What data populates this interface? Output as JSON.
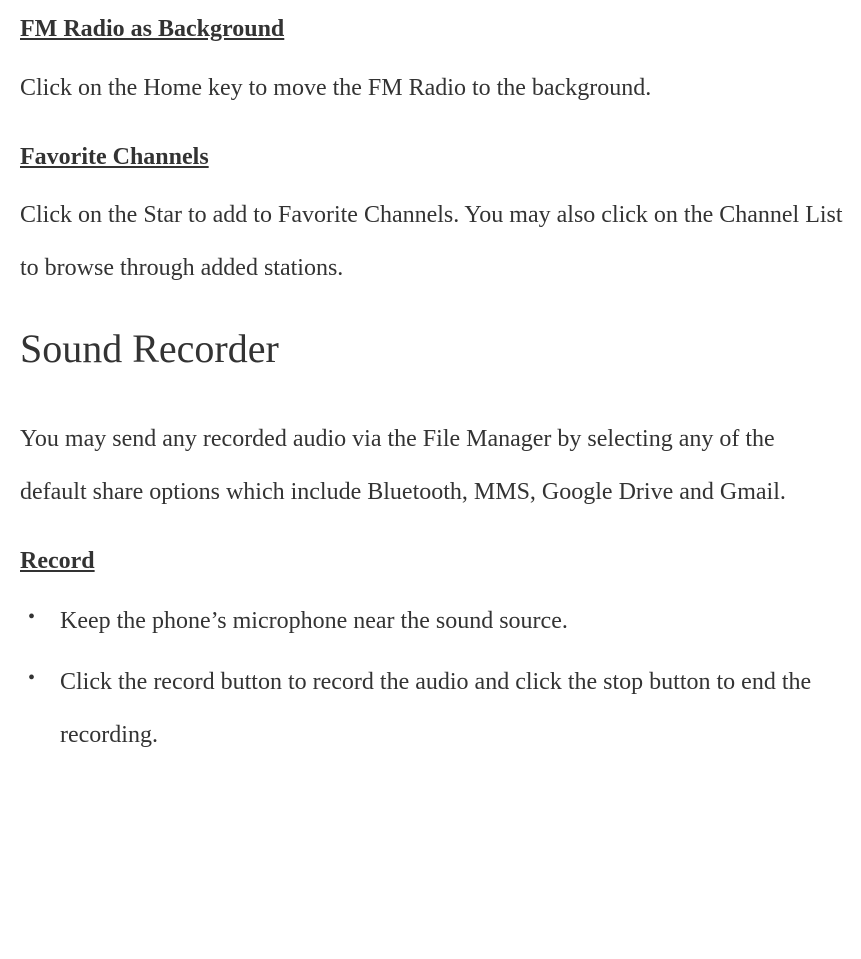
{
  "sections": {
    "fm_background": {
      "heading": "FM Radio as Background",
      "body": "Click on the Home key to move the FM Radio to the background."
    },
    "favorite_channels": {
      "heading": "Favorite Channels",
      "body": "Click on the Star to add to Favorite Channels. You may also click on the Channel List to browse through added stations."
    },
    "sound_recorder": {
      "title": "Sound Recorder",
      "intro": "You may send any recorded audio via the File Manager by selecting any of the default share options which include Bluetooth, MMS, Google Drive and Gmail."
    },
    "record": {
      "heading": "Record",
      "bullets": [
        "Keep the phone’s microphone near the sound source.",
        "Click the record button to record the audio and click the stop button to end the recording."
      ]
    }
  }
}
